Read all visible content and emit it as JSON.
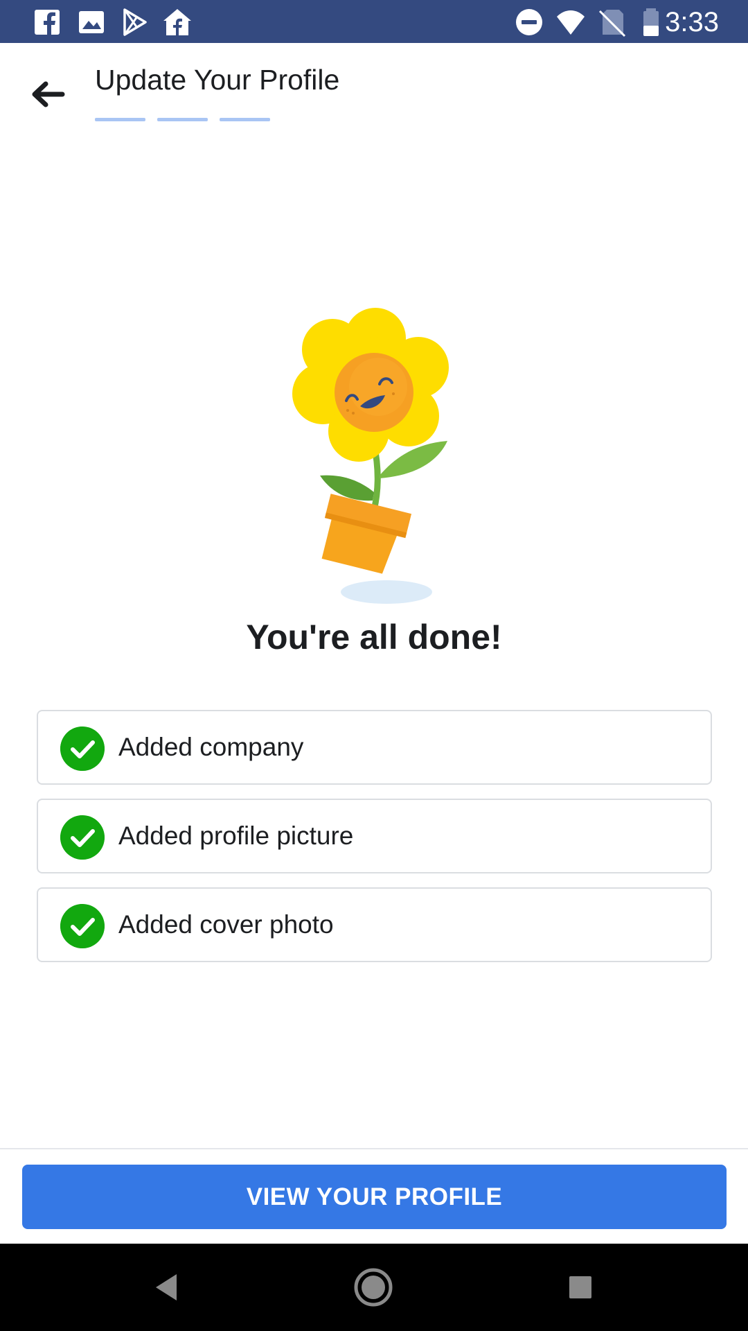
{
  "status_bar": {
    "time": "3:33",
    "left_icons": [
      "facebook-icon",
      "gallery-icon",
      "play-store-icon",
      "facebook-home-icon"
    ],
    "right_icons": [
      "do-not-disturb-icon",
      "wifi-icon",
      "no-sim-icon",
      "battery-icon"
    ]
  },
  "header": {
    "title": "Update Your Profile",
    "steps_completed": 3,
    "steps_total": 3
  },
  "main": {
    "done_title": "You're all done!",
    "checklist": [
      {
        "label": "Added company"
      },
      {
        "label": "Added profile picture"
      },
      {
        "label": "Added cover photo"
      }
    ]
  },
  "footer": {
    "primary_button_label": "VIEW YOUR PROFILE"
  },
  "nav_bar": {
    "buttons": [
      "back-nav-icon",
      "home-nav-icon",
      "recents-nav-icon"
    ]
  },
  "colors": {
    "status_bar": "#344a80",
    "accent": "#3578e5",
    "check_green": "#12a80f",
    "step_bar": "#a9c5f4"
  }
}
